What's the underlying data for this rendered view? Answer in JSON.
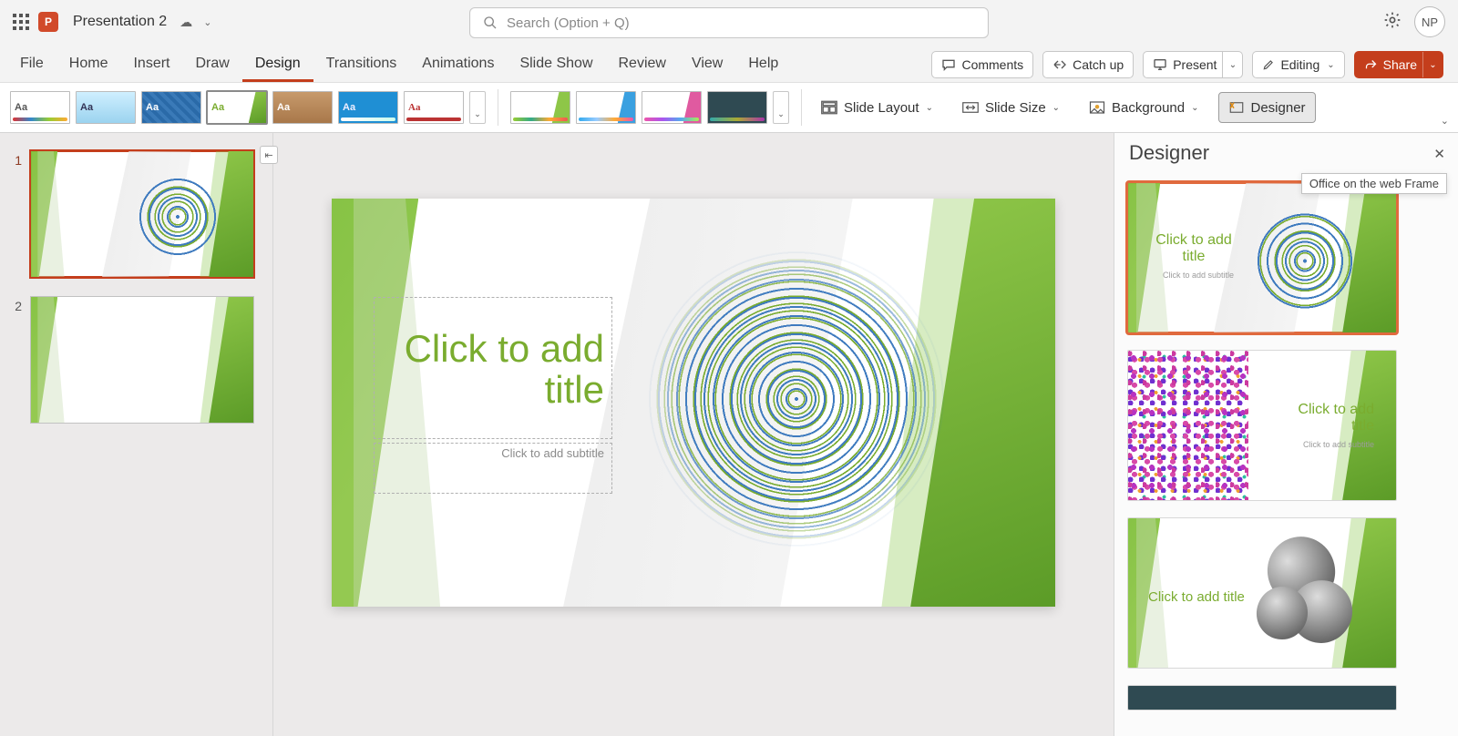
{
  "title": {
    "doc_name": "Presentation 2",
    "avatar_initials": "NP"
  },
  "search": {
    "placeholder": "Search (Option + Q)"
  },
  "tabs": {
    "items": [
      "File",
      "Home",
      "Insert",
      "Draw",
      "Design",
      "Transitions",
      "Animations",
      "Slide Show",
      "Review",
      "View",
      "Help"
    ],
    "active_index": 4
  },
  "tab_actions": {
    "comments": "Comments",
    "catchup": "Catch up",
    "present": "Present",
    "editing": "Editing",
    "share": "Share"
  },
  "ribbon": {
    "slide_layout": "Slide Layout",
    "slide_size": "Slide Size",
    "background": "Background",
    "designer": "Designer"
  },
  "thumbnails": {
    "slide1_num": "1",
    "slide2_num": "2"
  },
  "main_slide": {
    "title_placeholder": "Click to add title",
    "subtitle_placeholder": "Click to add subtitle"
  },
  "designer_pane": {
    "header": "Designer",
    "tooltip": "Office on the web Frame",
    "design1_title": "Click to add title",
    "design1_sub": "Click to add subtitle",
    "design2_title": "Click to add title",
    "design2_sub": "Click to add subtitle",
    "design3_title": "Click to add title"
  }
}
